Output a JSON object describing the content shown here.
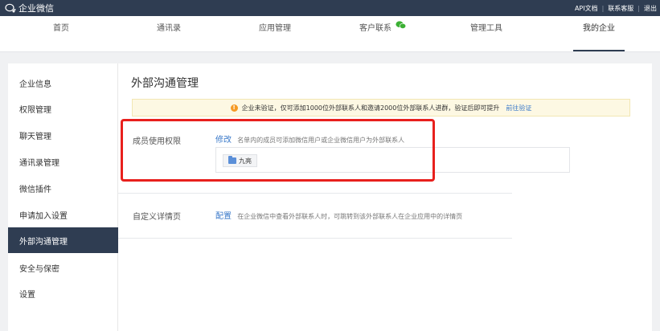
{
  "app": {
    "name": "企业微信",
    "links": [
      "API文档",
      "联系客服",
      "退出"
    ]
  },
  "nav": {
    "tabs": [
      {
        "label": "首页"
      },
      {
        "label": "通讯录"
      },
      {
        "label": "应用管理"
      },
      {
        "label": "客户联系",
        "icon": "wechat-icon"
      },
      {
        "label": "管理工具"
      },
      {
        "label": "我的企业",
        "active": true
      }
    ]
  },
  "sidebar": {
    "items": [
      {
        "label": "企业信息"
      },
      {
        "label": "权限管理"
      },
      {
        "label": "聊天管理"
      },
      {
        "label": "通讯录管理"
      },
      {
        "label": "微信插件"
      },
      {
        "label": "申请加入设置"
      },
      {
        "label": "外部沟通管理",
        "active": true
      },
      {
        "label": "安全与保密"
      },
      {
        "label": "设置"
      }
    ]
  },
  "main": {
    "title": "外部沟通管理",
    "warning": {
      "text": "企业未验证，仅可添加1000位外部联系人和邀请2000位外部联系人进群，验证后即可提升",
      "link": "前往验证"
    },
    "member_permission": {
      "label": "成员使用权限",
      "action": "修改",
      "desc": "名单内的成员可添加微信用户或企业微信用户为外部联系人",
      "members": [
        "九亮"
      ]
    },
    "custom_detail": {
      "label": "自定义详情页",
      "action": "配置",
      "desc": "在企业微信中查看外部联系人时，可跳转到该外部联系人在企业应用中的详情页"
    }
  },
  "colors": {
    "topbar": "#2f3d52",
    "link": "#3a79c9",
    "warning_bg": "#fdf8e3",
    "highlight": "#e8201d",
    "wechat": "#3cb034"
  }
}
